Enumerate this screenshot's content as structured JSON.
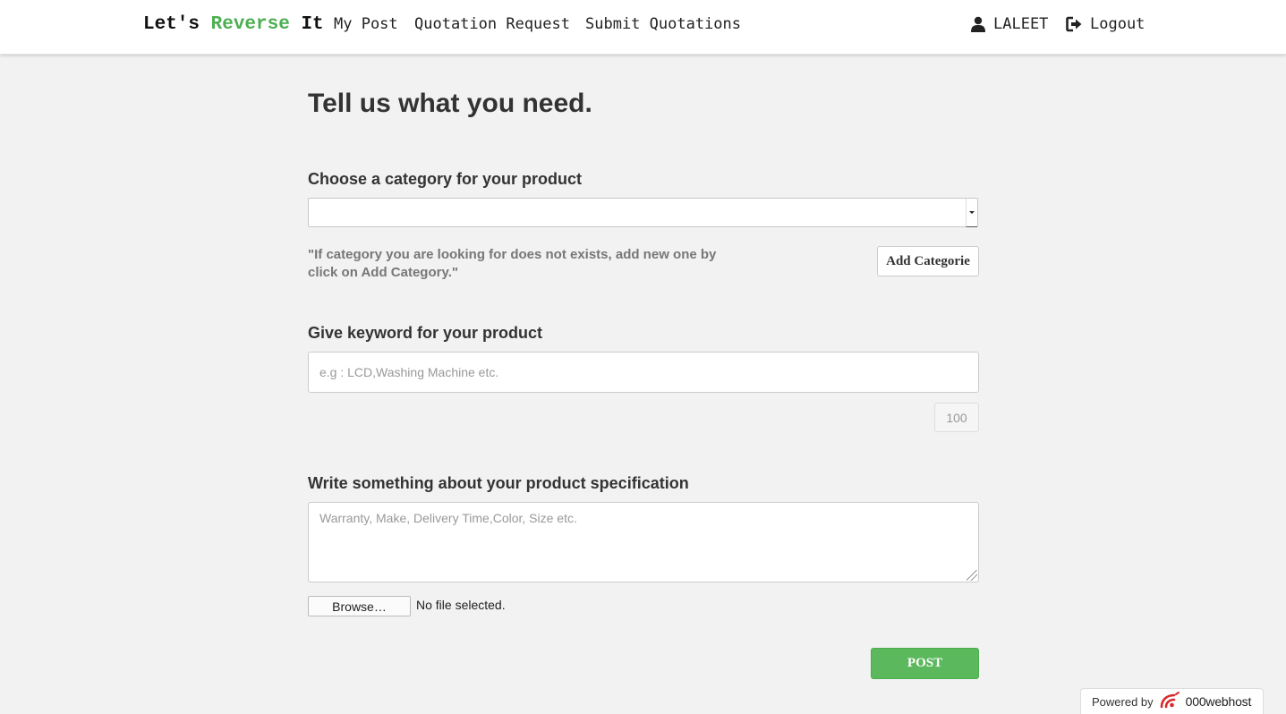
{
  "nav": {
    "brand_part1": "Let's ",
    "brand_accent": "Reverse",
    "brand_part2": " It",
    "links": [
      "My Post",
      "Quotation Request",
      "Submit Quotations"
    ],
    "user_name": "LALEET",
    "logout_label": "Logout",
    "accent_color": "#4caf50"
  },
  "form": {
    "title": "Tell us what you need.",
    "category_label": "Choose a category for your product",
    "category_selected": "",
    "category_hint": "\"If category you are looking for does not exists, add new one by click on Add Category.\"",
    "add_category_label": "Add Categorie",
    "keyword_label": "Give keyword for your product",
    "keyword_placeholder": "e.g : LCD,Washing Machine etc.",
    "keyword_value": "",
    "char_counter": "100",
    "spec_label": "Write something about your product specification",
    "spec_placeholder": "Warranty, Make, Delivery Time,Color, Size etc.",
    "browse_label": "Browse…",
    "file_status": "No file selected.",
    "post_label": "POST",
    "post_color": "#5cb85c"
  },
  "badge": {
    "powered_by": "Powered by",
    "host_name": "000webhost",
    "icon": "000webhost-logo-icon"
  }
}
